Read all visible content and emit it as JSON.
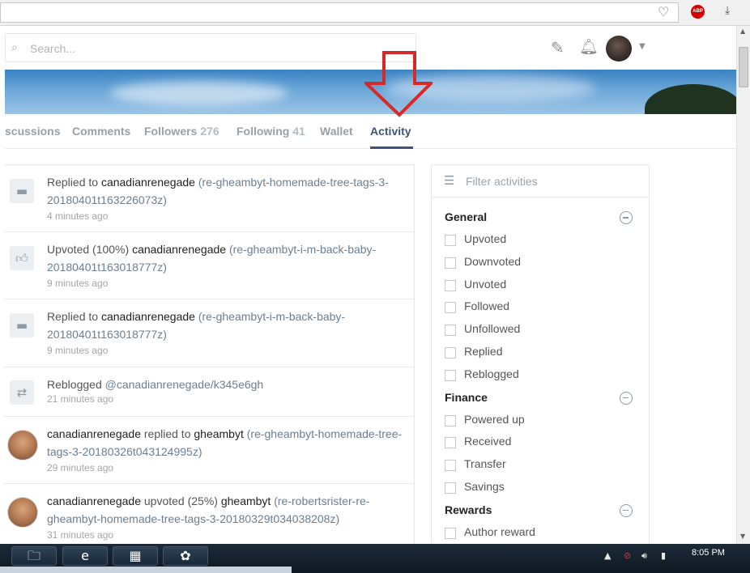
{
  "browser": {
    "url": "",
    "abp_label": "ABP"
  },
  "header": {
    "search_placeholder": "Search..."
  },
  "tabs": [
    {
      "label": "scussions",
      "count": ""
    },
    {
      "label": "Comments",
      "count": ""
    },
    {
      "label": "Followers",
      "count": "276"
    },
    {
      "label": "Following",
      "count": "41"
    },
    {
      "label": "Wallet",
      "count": ""
    },
    {
      "label": "Activity",
      "count": ""
    }
  ],
  "feed": {
    "items": [
      {
        "icon": "comment-icon",
        "parts": [
          {
            "kind": "plain",
            "text": "Replied to "
          },
          {
            "kind": "user",
            "text": "canadianrenegade"
          },
          {
            "kind": "link",
            "text": " (re-gheambyt-homemade-tree-tags-3-20180401t163226073z)"
          }
        ],
        "time": "4 minutes ago"
      },
      {
        "icon": "thumbs-up-icon",
        "parts": [
          {
            "kind": "plain",
            "text": "Upvoted (100%) "
          },
          {
            "kind": "user",
            "text": "canadianrenegade"
          },
          {
            "kind": "link",
            "text": " (re-gheambyt-i-m-back-baby-20180401t163018777z)"
          }
        ],
        "time": "9 minutes ago"
      },
      {
        "icon": "comment-icon",
        "parts": [
          {
            "kind": "plain",
            "text": "Replied to "
          },
          {
            "kind": "user",
            "text": "canadianrenegade"
          },
          {
            "kind": "link",
            "text": " (re-gheambyt-i-m-back-baby-20180401t163018777z)"
          }
        ],
        "time": "9 minutes ago"
      },
      {
        "icon": "reblog-icon",
        "parts": [
          {
            "kind": "plain",
            "text": "Reblogged "
          },
          {
            "kind": "link",
            "text": "@canadianrenegade/k345e6gh"
          }
        ],
        "time": "21 minutes ago"
      },
      {
        "icon": "avatar",
        "parts": [
          {
            "kind": "user",
            "text": "canadianrenegade"
          },
          {
            "kind": "plain",
            "text": " replied to "
          },
          {
            "kind": "user",
            "text": "gheambyt"
          },
          {
            "kind": "link",
            "text": " (re-gheambyt-homemade-tree-tags-3-20180326t043124995z)"
          }
        ],
        "time": "29 minutes ago"
      },
      {
        "icon": "avatar",
        "parts": [
          {
            "kind": "user",
            "text": "canadianrenegade"
          },
          {
            "kind": "plain",
            "text": " upvoted (25%) "
          },
          {
            "kind": "user",
            "text": "gheambyt"
          },
          {
            "kind": "link",
            "text": " (re-robertsrister-re-gheambyt-homemade-tree-tags-3-20180329t034038208z)"
          }
        ],
        "time": "31 minutes ago"
      }
    ]
  },
  "filter": {
    "placeholder": "Filter activities",
    "groups": [
      {
        "title": "General",
        "options": [
          "Upvoted",
          "Downvoted",
          "Unvoted",
          "Followed",
          "Unfollowed",
          "Replied",
          "Reblogged"
        ]
      },
      {
        "title": "Finance",
        "options": [
          "Powered up",
          "Received",
          "Transfer",
          "Savings"
        ]
      },
      {
        "title": "Rewards",
        "options": [
          "Author reward"
        ]
      }
    ]
  },
  "taskbar": {
    "clock": "8:05 PM"
  }
}
